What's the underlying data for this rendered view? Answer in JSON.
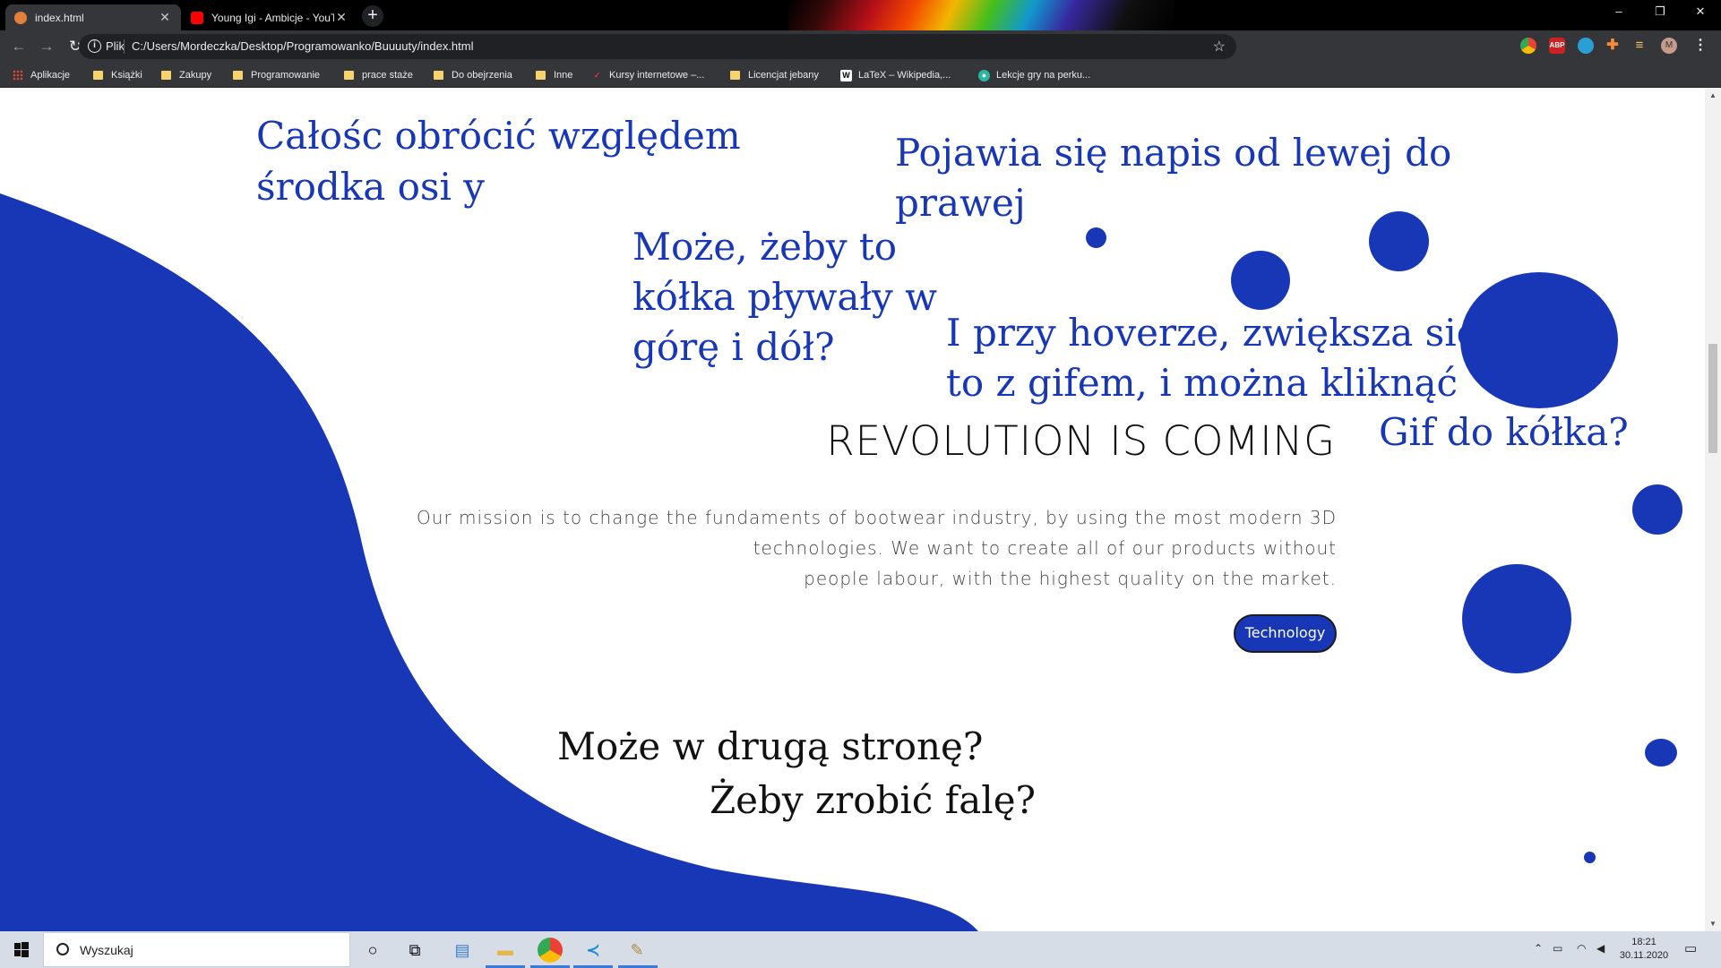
{
  "browser": {
    "tabs": [
      {
        "title": "index.html",
        "active": true
      },
      {
        "title": "Young Igi - Ambicje - YouTub",
        "active": false
      }
    ],
    "new_tab_symbol": "+",
    "close_symbol": "✕",
    "window_controls": {
      "minimize": "–",
      "restore": "❐",
      "close": "✕"
    },
    "omnibox": {
      "scheme_label": "Plik",
      "url": "C:/Users/Mordeczka/Desktop/Programowanko/Buuuuty/index.html"
    },
    "bookmarks": [
      {
        "label": "Aplikacje",
        "icon": "apps-grid-icon"
      },
      {
        "label": "Książki",
        "icon": "folder-icon"
      },
      {
        "label": "Zakupy",
        "icon": "folder-icon"
      },
      {
        "label": "Programowanie",
        "icon": "folder-icon"
      },
      {
        "label": "prace staże",
        "icon": "folder-icon"
      },
      {
        "label": "Do obejrzenia",
        "icon": "folder-icon"
      },
      {
        "label": "Inne",
        "icon": "folder-icon"
      },
      {
        "label": "Kursy internetowe –...",
        "icon": "site-icon"
      },
      {
        "label": "Licencjat jebany",
        "icon": "folder-icon"
      },
      {
        "label": "LaTeX – Wikipedia,...",
        "icon": "wikipedia-icon"
      },
      {
        "label": "Lekcje gry na perku...",
        "icon": "site-icon"
      }
    ],
    "extensions": {
      "abp": "ABP",
      "profile": "M"
    }
  },
  "page": {
    "notes": {
      "rotate_1": "Całośc obrócić względem",
      "rotate_2": "środka osi y",
      "appear_1": "Pojawia się napis od lewej do",
      "appear_2": "prawej",
      "float_1": "Może, żeby to",
      "float_2": "kółka pływały w",
      "float_3": "górę i dół?",
      "hover_1": "I przy hoverze, zwiększa się",
      "hover_2": "to z gifem, i można kliknąć",
      "gif": "Gif do kółka?",
      "wave_1": "Może w drugą stronę?",
      "wave_2": "Żeby zrobić falę?"
    },
    "headline": "REVOLUTION IS COMING",
    "mission_lines": [
      "Our mission is to change the fundaments of bootwear industry, by using the most modern 3D",
      "technologies. We want to create all of our products without",
      "people labour, with the highest quality on the market."
    ],
    "button_label": "Technology",
    "accent_color": "#1837b6"
  },
  "taskbar": {
    "search_placeholder": "Wyszukaj",
    "time": "18:21",
    "date": "30.11.2020"
  }
}
